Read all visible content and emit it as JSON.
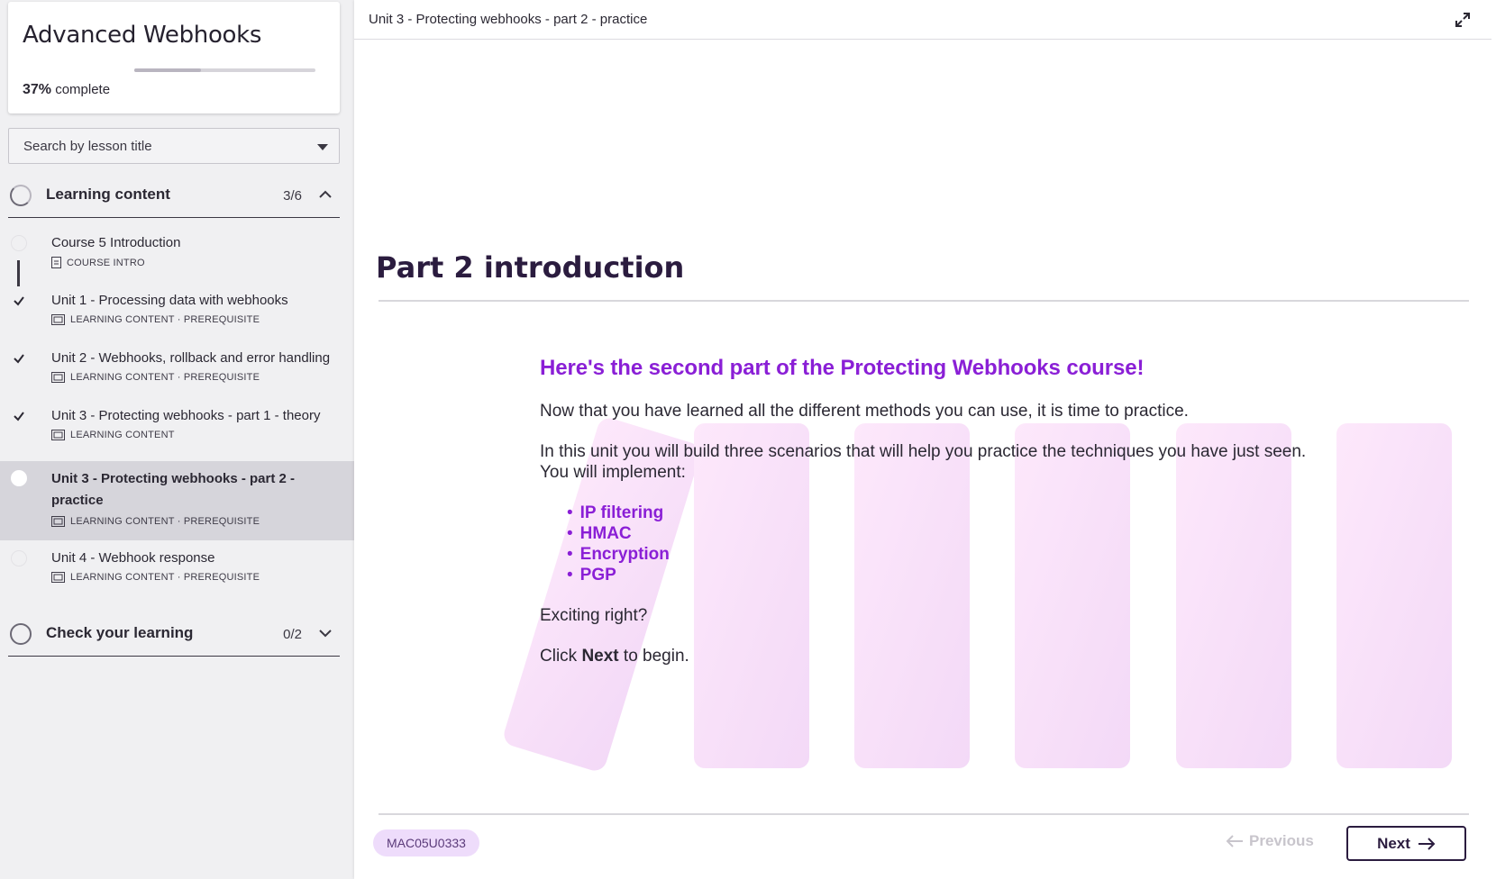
{
  "course": {
    "title": "Advanced Webhooks",
    "progress_pct": 37,
    "progress_percent_label": "37%",
    "progress_suffix": "complete"
  },
  "search": {
    "placeholder": "Search by lesson title"
  },
  "sections": [
    {
      "title": "Learning content",
      "count": "3/6",
      "expanded": true,
      "lessons": [
        {
          "title": "Course 5 Introduction",
          "meta": "COURSE INTRO",
          "completed": false,
          "active": false
        },
        {
          "title": "Unit 1 - Processing data with webhooks",
          "meta": "LEARNING CONTENT · PREREQUISITE",
          "completed": true,
          "active": false
        },
        {
          "title": "Unit 2 - Webhooks, rollback and error handling",
          "meta": "LEARNING CONTENT · PREREQUISITE",
          "completed": true,
          "active": false
        },
        {
          "title": "Unit 3 - Protecting webhooks - part 1 - theory",
          "meta": "LEARNING CONTENT",
          "completed": true,
          "active": false
        },
        {
          "title": "Unit 3 - Protecting webhooks - part 2 - practice",
          "meta": "LEARNING CONTENT · PREREQUISITE",
          "completed": false,
          "active": true
        },
        {
          "title": "Unit 4 - Webhook response",
          "meta": "LEARNING CONTENT · PREREQUISITE",
          "completed": false,
          "active": false
        }
      ]
    },
    {
      "title": "Check your learning",
      "count": "0/2",
      "expanded": false
    }
  ],
  "topbar": {
    "breadcrumb": "Unit 3 - Protecting webhooks - part 2 - practice",
    "expand_icon": "expand-icon"
  },
  "lesson_page": {
    "title": "Part 2 introduction",
    "headline": "Here's the second part of the Protecting Webhooks course!",
    "para1": "Now that you have learned all the different methods you can use, it is time to practice.",
    "para2": "In this unit you will build three scenarios that will help you practice the techniques you have just seen. You will implement:",
    "bullets": [
      "IP filtering",
      "HMAC",
      "Encryption",
      "PGP"
    ],
    "para3": "Exciting right?",
    "para4_prefix": "Click ",
    "para4_bold": "Next",
    "para4_suffix": " to begin."
  },
  "footer": {
    "code": "MAC05U0333",
    "previous_label": "Previous",
    "next_label": "Next"
  },
  "colors": {
    "accent_purple": "#8a1fd6",
    "dark_navy": "#2b1c3f",
    "badge_bg": "#eedcfb"
  }
}
